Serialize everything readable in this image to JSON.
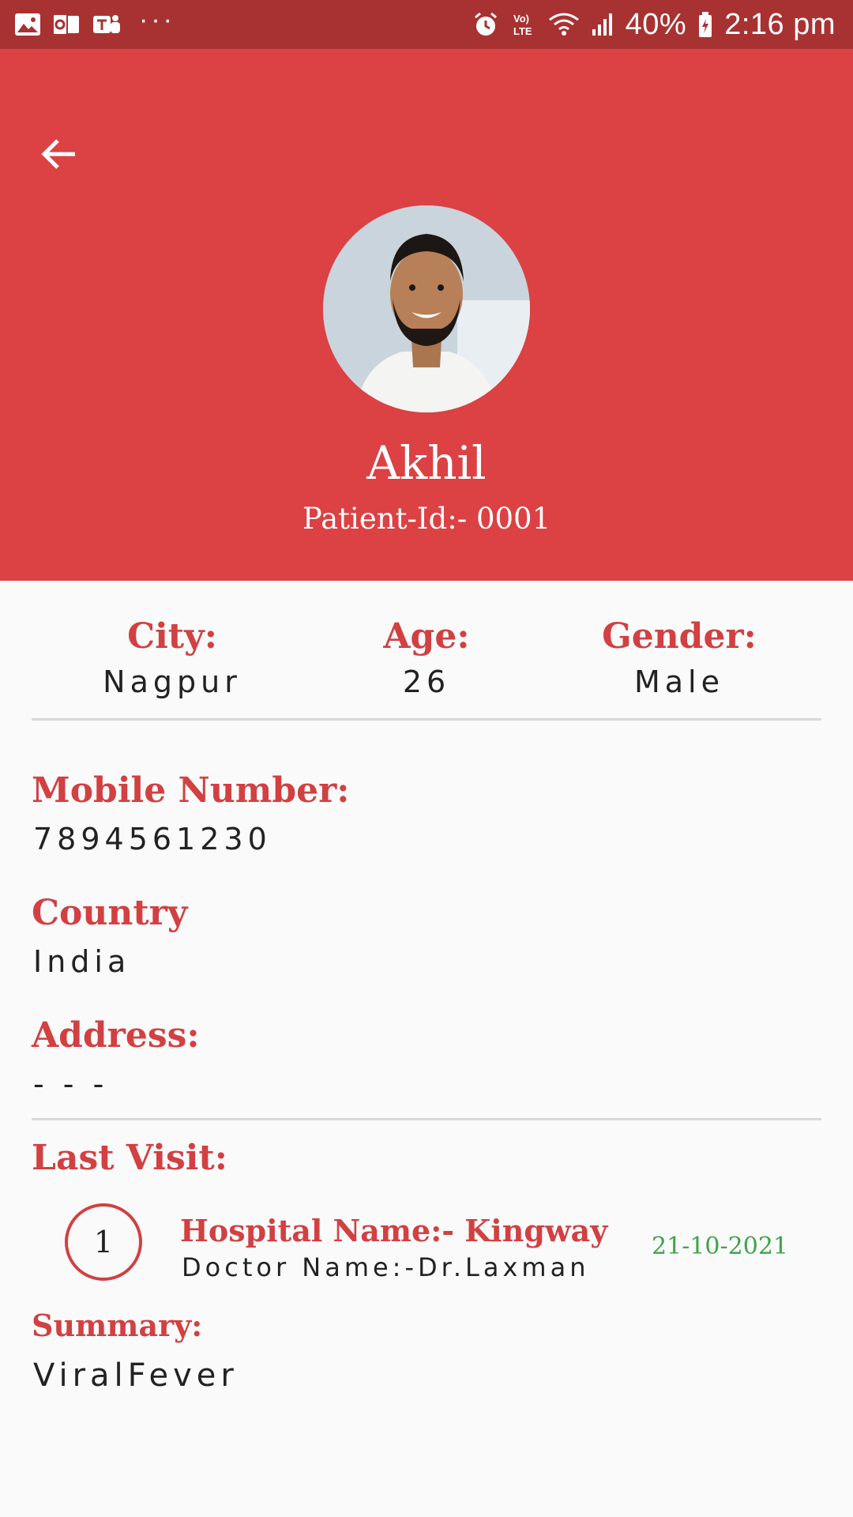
{
  "status_bar": {
    "battery": "40%",
    "time": "2:16 pm",
    "overflow": "···",
    "icons": [
      "gallery-icon",
      "outlook-icon",
      "teams-icon",
      "alarm-icon",
      "volte-icon",
      "wifi-icon",
      "signal-icon",
      "battery-icon"
    ]
  },
  "header": {
    "back_icon": "arrow-left-icon",
    "name": "Akhil",
    "patient_id": "Patient-Id:- 0001",
    "color": "#dc4143"
  },
  "summary": {
    "city_label": "City:",
    "city_value": "Nagpur",
    "age_label": "Age:",
    "age_value": "26",
    "gender_label": "Gender:",
    "gender_value": "Male"
  },
  "details": {
    "mobile_label": "Mobile Number:",
    "mobile_value": "7894561230",
    "country_label": "Country",
    "country_value": "India",
    "address_label": "Address:",
    "address_value": "- - -"
  },
  "last_visit": {
    "title": "Last Visit:",
    "number": "1",
    "hospital": "Hospital Name:- Kingway",
    "doctor": "Doctor Name:-Dr.Laxman",
    "date": "21-10-2021",
    "summary_label": "Summary:",
    "summary_value": "ViralFever"
  },
  "colors": {
    "accent": "#d24042",
    "status_bar": "#a83232",
    "date": "#3ea34a"
  }
}
